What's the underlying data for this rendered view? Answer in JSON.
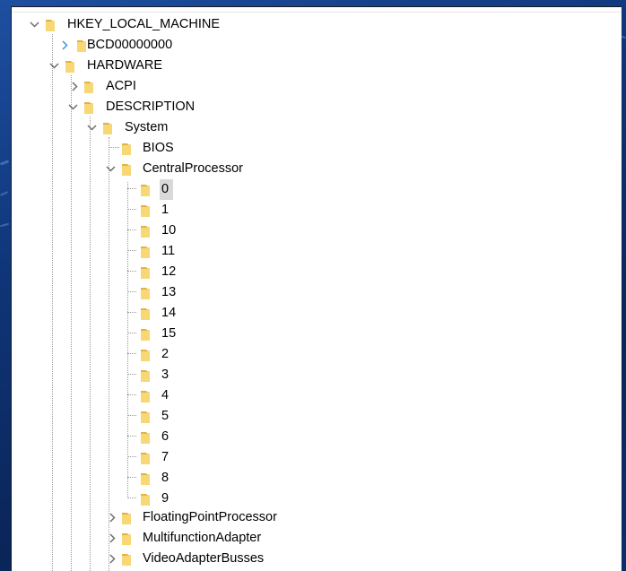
{
  "colors": {
    "folder_yellow": "#f8d775",
    "folder_dark": "#e3b341",
    "selection_bg": "#d9d9d9",
    "caret_blue": "#3a96dd",
    "caret_gray": "#6d6d6d"
  },
  "tree": {
    "hklm": {
      "label": "HKEY_LOCAL_MACHINE",
      "state": "expanded"
    },
    "bcd": {
      "label": "BCD00000000",
      "state": "collapsed-hover"
    },
    "hardware": {
      "label": "HARDWARE",
      "state": "expanded"
    },
    "acpi": {
      "label": "ACPI",
      "state": "collapsed"
    },
    "description": {
      "label": "DESCRIPTION",
      "state": "expanded"
    },
    "system": {
      "label": "System",
      "state": "expanded"
    },
    "bios": {
      "label": "BIOS",
      "state": "leaf"
    },
    "central_processor": {
      "label": "CentralProcessor",
      "state": "expanded"
    },
    "cpu_keys": [
      "0",
      "1",
      "10",
      "11",
      "12",
      "13",
      "14",
      "15",
      "2",
      "3",
      "4",
      "5",
      "6",
      "7",
      "8",
      "9"
    ],
    "selected_cpu_key": "0",
    "floating_point": {
      "label": "FloatingPointProcessor",
      "state": "collapsed"
    },
    "multifunction": {
      "label": "MultifunctionAdapter",
      "state": "collapsed"
    },
    "video_busses": {
      "label": "VideoAdapterBusses",
      "state": "collapsed"
    }
  }
}
